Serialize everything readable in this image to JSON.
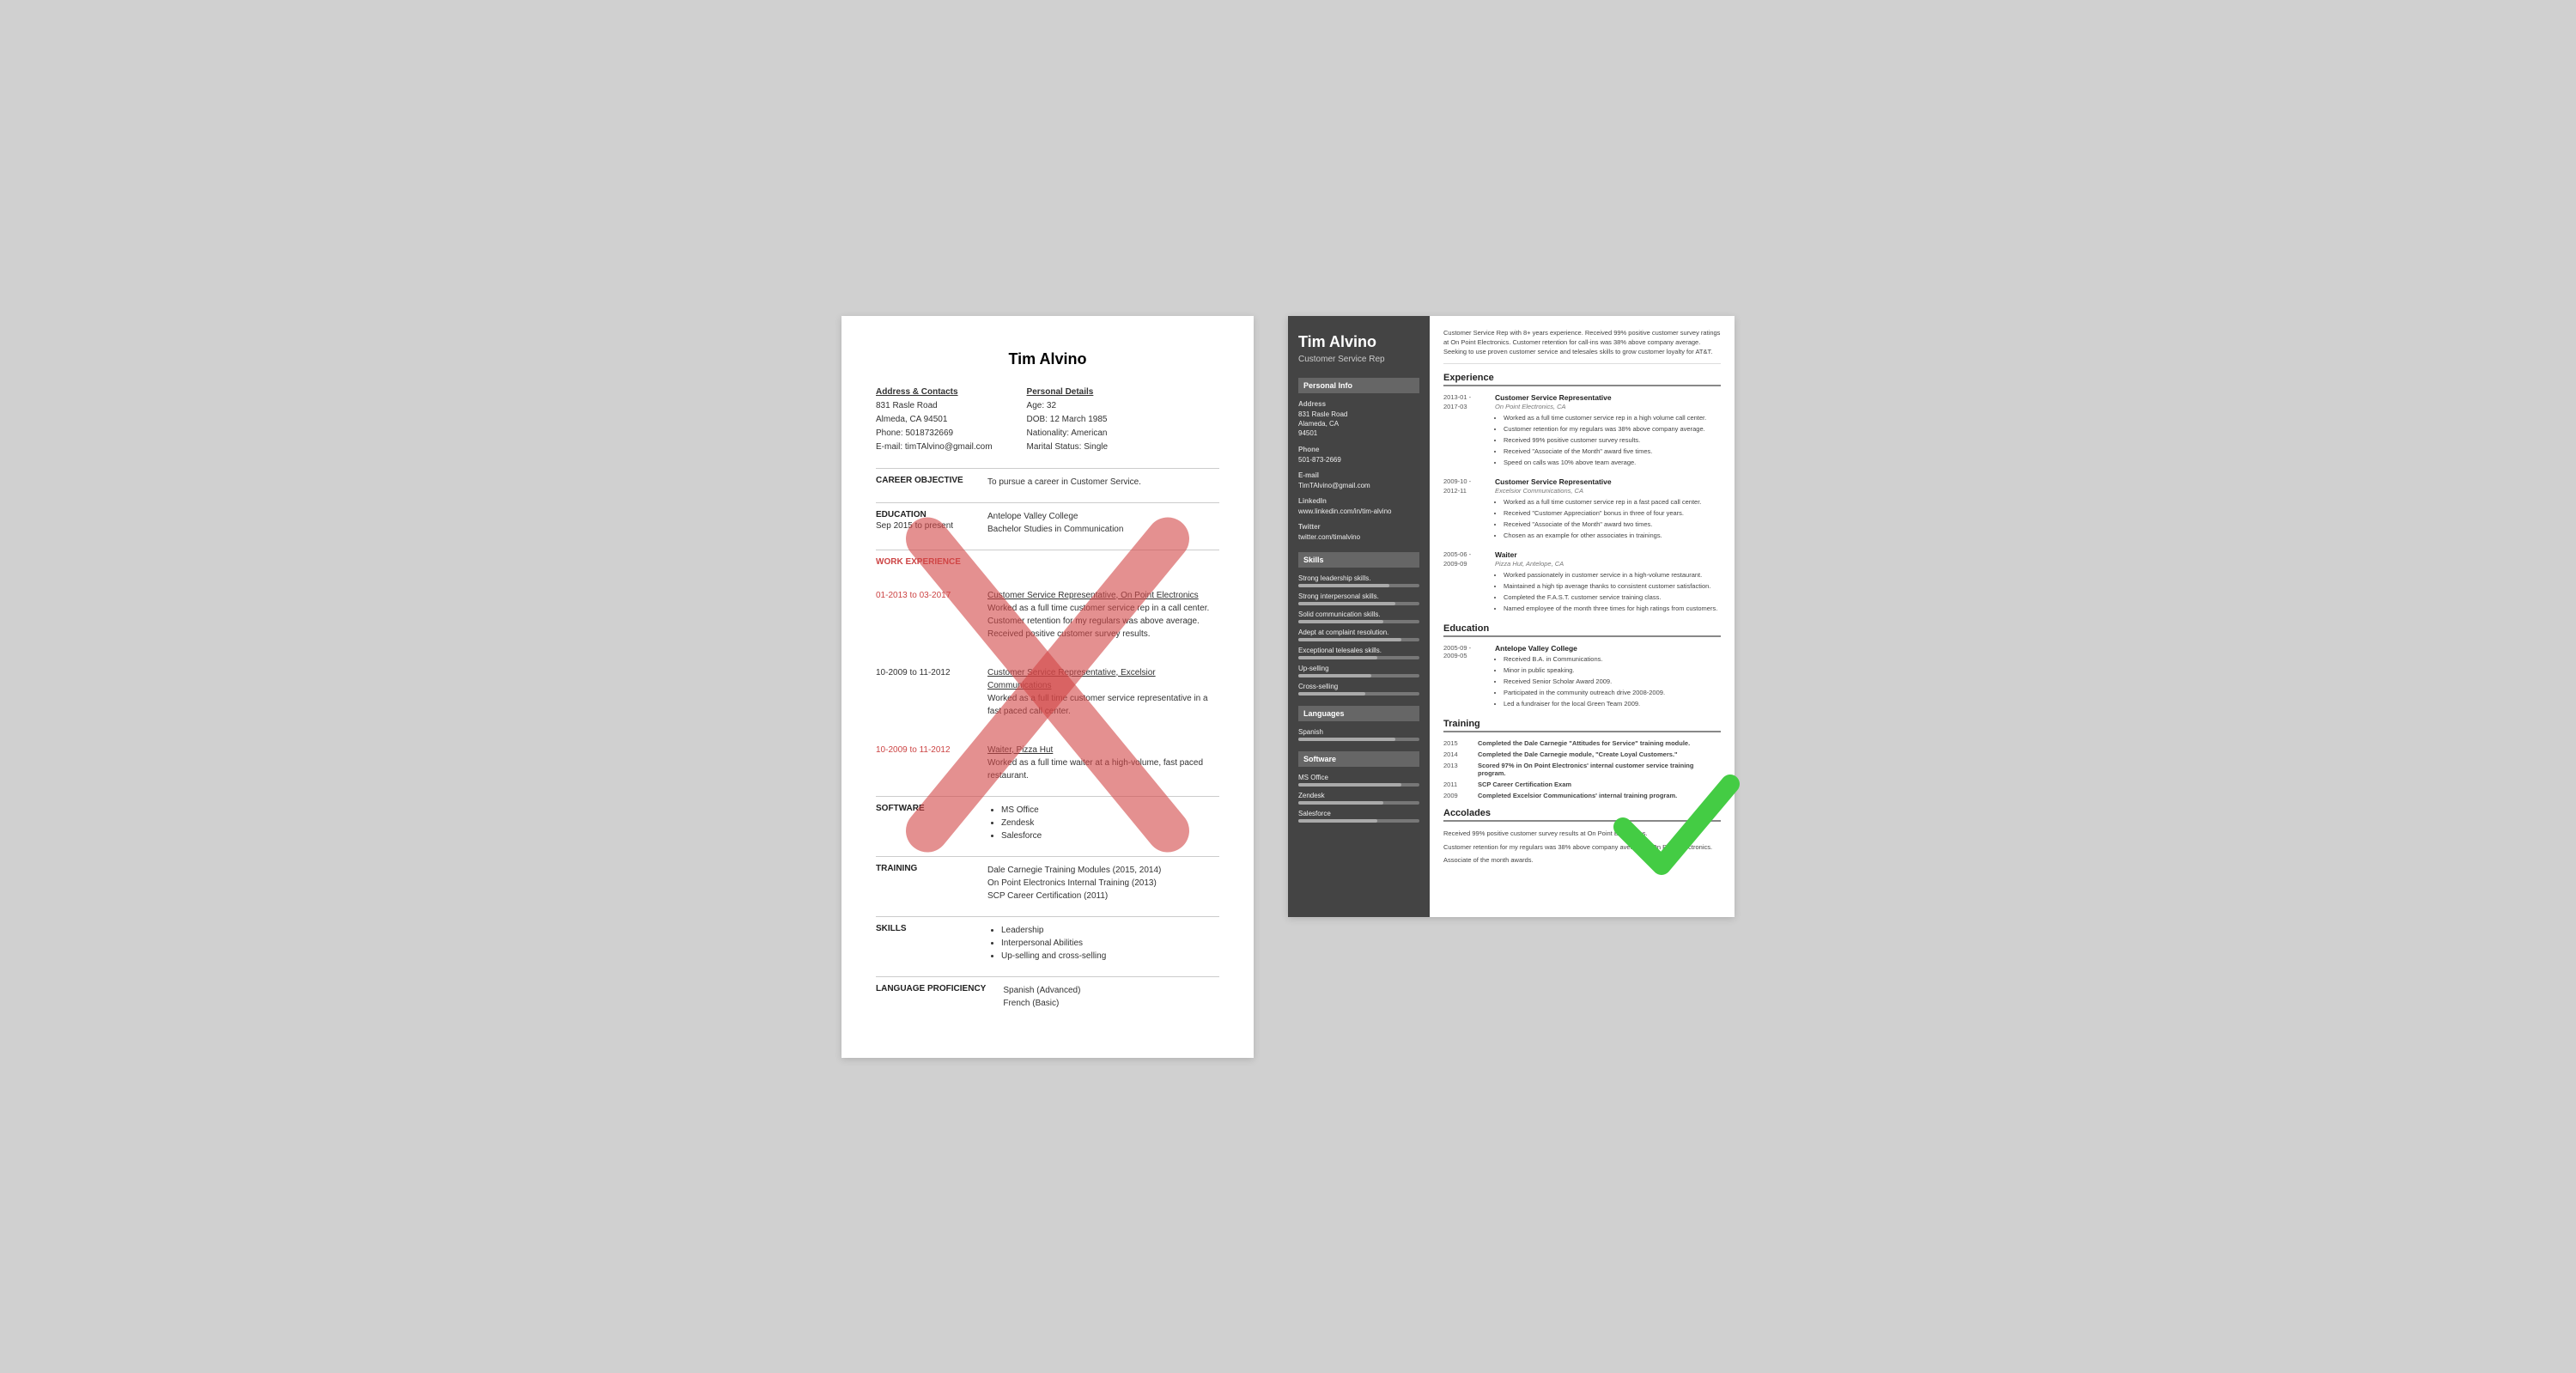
{
  "bad_resume": {
    "title": "Tim Alvino",
    "address_label": "Address & Contacts",
    "address_lines": [
      "831 Rasle Road",
      "Almeda, CA 94501",
      "Phone: 5018732669",
      "E-mail: timTAlvino@gmail.com"
    ],
    "personal_label": "Personal Details",
    "personal_lines": [
      "Age:   32",
      "DOB:  12 March 1985",
      "Nationality: American",
      "Marital Status: Single"
    ],
    "sections": [
      {
        "label": "CAREER OBJECTIVE",
        "content": "To pursue a career in Customer Service."
      },
      {
        "label": "EDUCATION",
        "sublabel": "Sep 2015 to present",
        "content": "Antelope Valley College\nBachelor Studies in Communication"
      },
      {
        "label": "WORK EXPERIENCE",
        "entries": [
          {
            "date": "01-2013 to 03-2017",
            "title": "Customer Service Representative, On Point Electronics",
            "desc": "Worked as a full time customer service rep in a call center. Customer retention for my regulars was above average. Received positive customer survey results."
          },
          {
            "date": "10-2009 to 11-2012",
            "title": "Customer Service Representative, Excelsior Communications",
            "desc": "Worked as a full time customer service representative in a fast paced call center."
          },
          {
            "date": "10-2009 to 11-2012",
            "title": "Waiter, Pizza Hut",
            "desc": "Worked as a full time waiter at a high-volume, fast paced restaurant."
          }
        ]
      },
      {
        "label": "SOFTWARE",
        "bullets": [
          "MS Office",
          "Zendesk",
          "Salesforce"
        ]
      },
      {
        "label": "TRAINING",
        "content": "Dale Carnegie Training Modules (2015, 2014)\nOn Point Electronics Internal Training (2013)\nSCP Career Certification (2011)"
      },
      {
        "label": "SKILLS",
        "bullets": [
          "Leadership",
          "Interpersonal Abilities",
          "Up-selling and cross-selling"
        ]
      },
      {
        "label": "LANGUAGE PROFICIENCY",
        "content": "Spanish (Advanced)\nFrench (Basic)"
      }
    ]
  },
  "good_resume": {
    "name": "Tim Alvino",
    "job_title": "Customer Service Rep",
    "summary": "Customer Service Rep with 8+ years experience. Received 99% positive customer survey ratings at On Point Electronics. Customer retention for call-ins was 38% above company average. Seeking to use proven customer service and telesales skills to grow customer loyalty for AT&T.",
    "sidebar": {
      "personal_info_title": "Personal Info",
      "fields": [
        {
          "label": "Address",
          "value": "831 Rasle Road\nAlameda, CA\n94501"
        },
        {
          "label": "Phone",
          "value": "501-873-2669"
        },
        {
          "label": "E-mail",
          "value": "TimTAlvino@gmail.com"
        },
        {
          "label": "LinkedIn",
          "value": "www.linkedin.com/in/tim-alvino"
        },
        {
          "label": "Twitter",
          "value": "twitter.com/timalvino"
        }
      ],
      "skills_title": "Skills",
      "skills": [
        {
          "name": "Strong leadership skills.",
          "pct": 75
        },
        {
          "name": "Strong interpersonal skills.",
          "pct": 80
        },
        {
          "name": "Solid communication skills.",
          "pct": 70
        },
        {
          "name": "Adept at complaint resolution.",
          "pct": 85
        },
        {
          "name": "Exceptional telesales skills.",
          "pct": 65
        },
        {
          "name": "Up-selling",
          "pct": 60
        },
        {
          "name": "Cross-selling",
          "pct": 55
        }
      ],
      "languages_title": "Languages",
      "languages": [
        {
          "name": "Spanish",
          "pct": 80
        }
      ],
      "software_title": "Software",
      "software": [
        {
          "name": "MS Office",
          "pct": 85
        },
        {
          "name": "Zendesk",
          "pct": 70
        },
        {
          "name": "Salesforce",
          "pct": 65
        }
      ]
    },
    "experience_title": "Experience",
    "experience": [
      {
        "date": "2013-01 -\n2017-03",
        "title": "Customer Service Representative",
        "company": "On Point Electronics, CA",
        "bullets": [
          "Worked as a full time customer service rep in a high volume call center.",
          "Customer retention for my regulars was 38% above company average.",
          "Received 99% positive customer survey results.",
          "Received \"Associate of the Month\" award five times.",
          "Speed on calls was 10% above team average."
        ]
      },
      {
        "date": "2009-10 -\n2012-11",
        "title": "Customer Service Representative",
        "company": "Excelsior Communications, CA",
        "bullets": [
          "Worked as a full time customer service rep in a fast paced call center.",
          "Received \"Customer Appreciation\" bonus in three of four years.",
          "Received \"Associate of the Month\" award two times.",
          "Chosen as an example for other associates in trainings."
        ]
      },
      {
        "date": "2005-06 -\n2009-09",
        "title": "Waiter",
        "company": "Pizza Hut, Antelope, CA",
        "bullets": [
          "Worked passionately in customer service in a high-volume restaurant.",
          "Maintained a high tip average thanks to consistent customer satisfaction.",
          "Completed the F.A.S.T. customer service training class.",
          "Named employee of the month three times for high ratings from customers."
        ]
      }
    ],
    "education_title": "Education",
    "education": [
      {
        "date": "2005-09 -\n2009-05",
        "school": "Antelope Valley College",
        "bullets": [
          "Received B.A. in Communications.",
          "Minor in public speaking.",
          "Received Senior Scholar Award 2009.",
          "Participated in the community outreach drive 2008-2009.",
          "Led a fundraiser for the local Green Team 2009."
        ]
      }
    ],
    "training_title": "Training",
    "training": [
      {
        "year": "2015",
        "text": "Completed the Dale Carnegie \"Attitudes for Service\" training module."
      },
      {
        "year": "2014",
        "text": "Completed the Dale Carnegie module, \"Create Loyal Customers.\""
      },
      {
        "year": "2013",
        "text": "Scored 97% in On Point Electronics' internal customer service training program."
      },
      {
        "year": "2011",
        "text": "SCP Career Certification Exam"
      },
      {
        "year": "2009",
        "text": "Completed Excelsior Communications' internal training program."
      }
    ],
    "accolades_title": "Accolades",
    "accolades": [
      "Received 99% positive customer survey results at On Point Electronics.",
      "Customer retention for my regulars was 38% above company average at On Point Electronics.",
      "Associate of the month awards."
    ]
  }
}
